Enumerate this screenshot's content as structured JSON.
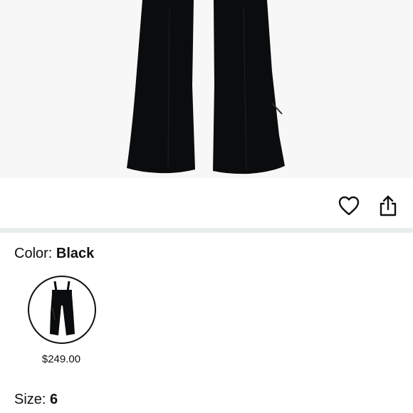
{
  "product": {
    "image_icon": "black-ski-pants-image",
    "image_color": "#0b0c0d"
  },
  "actions": {
    "favorite_icon": "heart-outline-icon",
    "share_icon": "share-icon"
  },
  "color": {
    "label": "Color:",
    "value": "Black",
    "swatch_icon": "black-ski-pants-thumbnail"
  },
  "swatch": {
    "price": "$249.00"
  },
  "size": {
    "label": "Size:",
    "value": "6"
  }
}
